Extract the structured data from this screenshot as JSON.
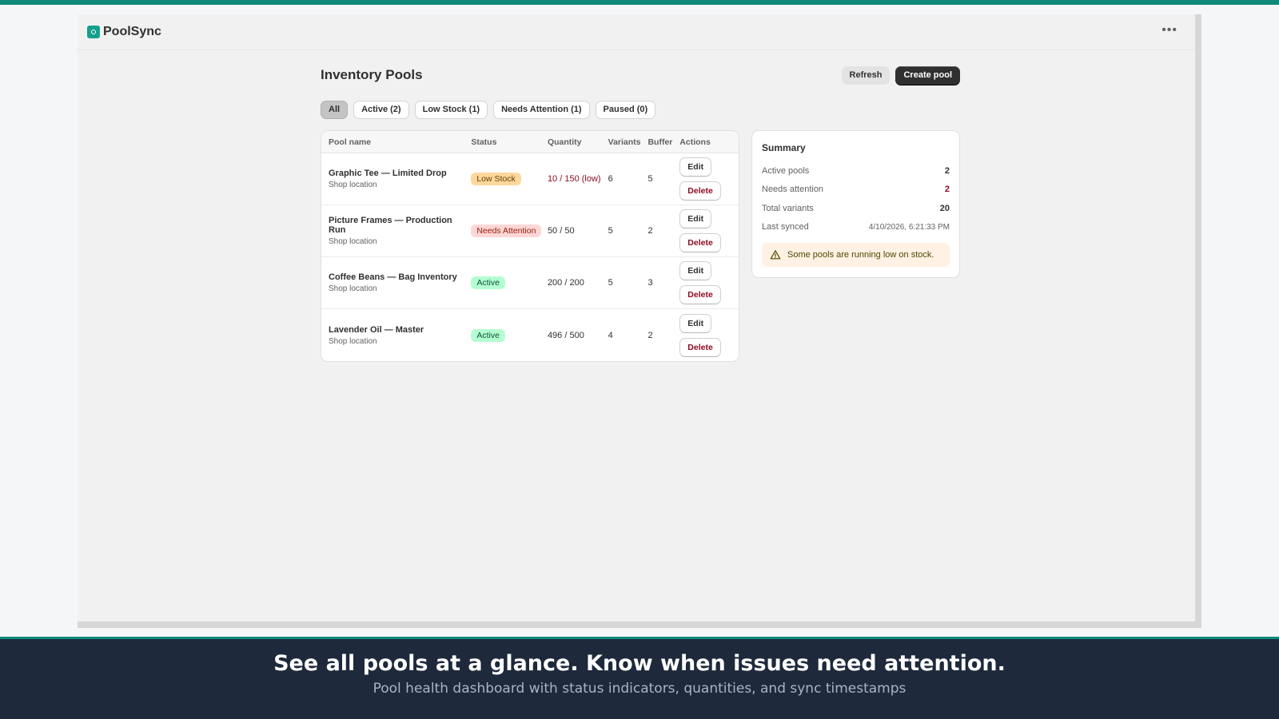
{
  "app": {
    "name": "PoolSync",
    "menu_icon": "more-horizontal-icon"
  },
  "page": {
    "title": "Inventory Pools",
    "refresh_label": "Refresh",
    "create_label": "Create pool"
  },
  "tabs": [
    {
      "label": "All",
      "selected": true
    },
    {
      "label": "Active (2)",
      "selected": false
    },
    {
      "label": "Low Stock (1)",
      "selected": false
    },
    {
      "label": "Needs Attention (1)",
      "selected": false
    },
    {
      "label": "Paused (0)",
      "selected": false
    }
  ],
  "table": {
    "headers": {
      "name": "Pool name",
      "status": "Status",
      "quantity": "Quantity",
      "variants": "Variants",
      "buffer": "Buffer",
      "actions": "Actions"
    },
    "rows": [
      {
        "name": "Graphic Tee — Limited Drop",
        "location": "Shop location",
        "status": "Low Stock",
        "status_kind": "low",
        "quantity": "10 / 150 (low)",
        "variants": "6",
        "buffer": "5",
        "edit": "Edit",
        "delete": "Delete"
      },
      {
        "name": "Picture Frames — Production Run",
        "location": "Shop location",
        "status": "Needs Attention",
        "status_kind": "attn",
        "quantity": "50 / 50",
        "variants": "5",
        "buffer": "2",
        "edit": "Edit",
        "delete": "Delete"
      },
      {
        "name": "Coffee Beans — Bag Inventory",
        "location": "Shop location",
        "status": "Active",
        "status_kind": "active",
        "quantity": "200 / 200",
        "variants": "5",
        "buffer": "3",
        "edit": "Edit",
        "delete": "Delete"
      },
      {
        "name": "Lavender Oil — Master",
        "location": "Shop location",
        "status": "Active",
        "status_kind": "active",
        "quantity": "496 / 500",
        "variants": "4",
        "buffer": "2",
        "edit": "Edit",
        "delete": "Delete"
      }
    ]
  },
  "summary": {
    "title": "Summary",
    "active_pools_label": "Active pools",
    "active_pools": "2",
    "needs_attention_label": "Needs attention",
    "needs_attention": "2",
    "total_variants_label": "Total variants",
    "total_variants": "20",
    "last_synced_label": "Last synced",
    "last_synced": "4/10/2026, 6:21:33 PM",
    "warning": "Some pools are running low on stock."
  },
  "caption": {
    "headline": "See all pools at a glance. Know when issues need attention.",
    "subline": "Pool health dashboard with status indicators, quantities, and sync timestamps"
  },
  "colors": {
    "brand": "#12a08d",
    "accent_strip": "#0f8a7a",
    "critical": "#8e0b21",
    "caption_bg": "#1e293b"
  }
}
